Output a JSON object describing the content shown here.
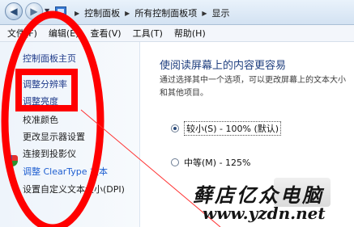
{
  "window": {
    "breadcrumbs": [
      "控制面板",
      "所有控制面板项",
      "显示"
    ]
  },
  "menu": {
    "items": [
      "文件(F)",
      "编辑(E)",
      "查看(V)",
      "工具(T)",
      "帮助(H)"
    ]
  },
  "sidebar": {
    "items": [
      {
        "label": "控制面板主页"
      },
      {
        "label": "调整分辨率"
      },
      {
        "label": "调整亮度"
      },
      {
        "label": "校准颜色"
      },
      {
        "label": "更改显示器设置"
      },
      {
        "label": "连接到投影仪"
      },
      {
        "label": "调整 ClearType 文本"
      },
      {
        "label": "设置自定义文本大小(DPI)"
      }
    ]
  },
  "main": {
    "title": "使阅读屏幕上的内容更容易",
    "description": "通过选择其中一个选项，可以更改屏幕上的文本大小和其他项目。",
    "options": [
      {
        "label": "较小(S) - 100% (默认)",
        "selected": true
      },
      {
        "label": "中等(M) - 125%",
        "selected": false
      }
    ]
  },
  "watermark": {
    "text": "藓店亿众电脑",
    "url": "www.yzdn.net"
  },
  "annotation_colors": {
    "highlight": "#ff0000"
  }
}
